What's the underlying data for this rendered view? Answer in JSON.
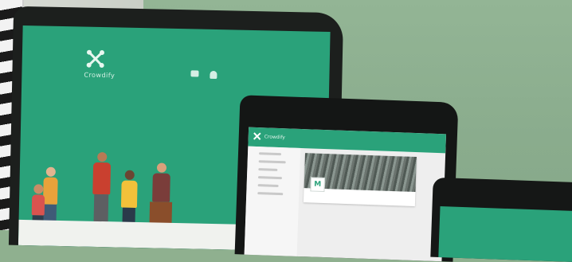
{
  "scene": {
    "description_free": true,
    "colors": {
      "wall": "#8fb08f",
      "brand_green": "#2aa27a",
      "device_frame": "#1c1f1d",
      "screen_light": "#eeeeee"
    }
  },
  "devices": {
    "laptop": {
      "brand_text": "Crowdify",
      "icons": [
        "logo-x-icon",
        "chat-icon",
        "bell-icon"
      ]
    },
    "tablet": {
      "brand_text": "Crowdify",
      "card_badge": "M",
      "icons": [
        "logo-x-icon"
      ]
    },
    "phone": {
      "icons": []
    }
  }
}
